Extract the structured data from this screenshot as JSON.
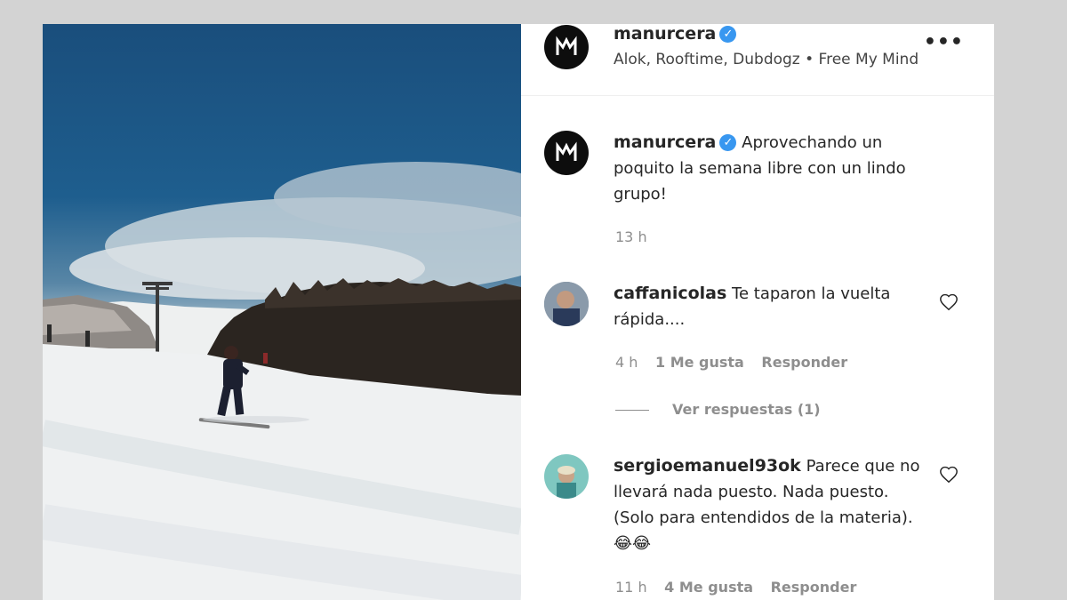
{
  "post": {
    "author": "manurcera",
    "audio": "Alok, Rooftime, Dubdogz • Free My Mind",
    "more_icon": "•••"
  },
  "caption": {
    "author": "manurcera",
    "text": "Aprovechando un poquito la semana libre con un lindo grupo!",
    "time": "13 h"
  },
  "comments": [
    {
      "user": "caffanicolas",
      "text": "Te taparon la vuelta rápida....",
      "time": "4 h",
      "likes": "1 Me gusta",
      "reply": "Responder",
      "view_replies": "Ver respuestas (1)"
    },
    {
      "user": "sergioemanuel93ok",
      "text": "Parece que no llevará nada puesto. Nada puesto. (Solo para entendidos de la materia).😂😂",
      "time": "11 h",
      "likes": "4 Me gusta",
      "reply": "Responder"
    }
  ],
  "colors": {
    "verified": "#3897f0",
    "secondary_text": "#8e8e8e",
    "primary_text": "#262626"
  },
  "icons": [
    "verified-badge-icon",
    "more-options-icon",
    "heart-icon",
    "avatar-logo-icon"
  ]
}
